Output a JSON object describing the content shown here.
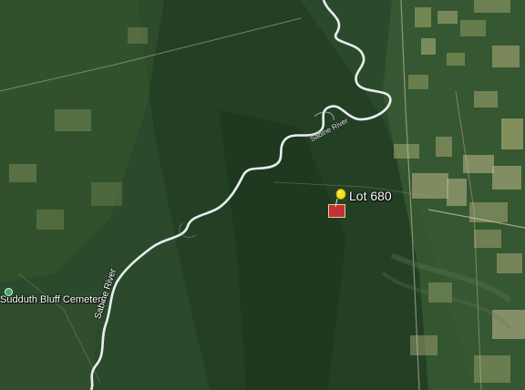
{
  "map": {
    "type": "satellite",
    "accent_colors": {
      "forest": "#2d4f2e",
      "river": "#e8eef0",
      "parcel_fill": "#c8323a",
      "parcel_border": "#f2d98a",
      "pushpin": "#f3e21a",
      "cemetery_marker": "#3ea868"
    }
  },
  "placemarks": {
    "lot": {
      "label": "Lot 680",
      "icon": "pushpin-icon"
    },
    "cemetery": {
      "label": "Sudduth Bluff Cemetery",
      "icon": "cemetery-marker-icon"
    }
  },
  "waterways": {
    "river_label": "Sabine River",
    "river_label_upper": "Sabine River"
  }
}
